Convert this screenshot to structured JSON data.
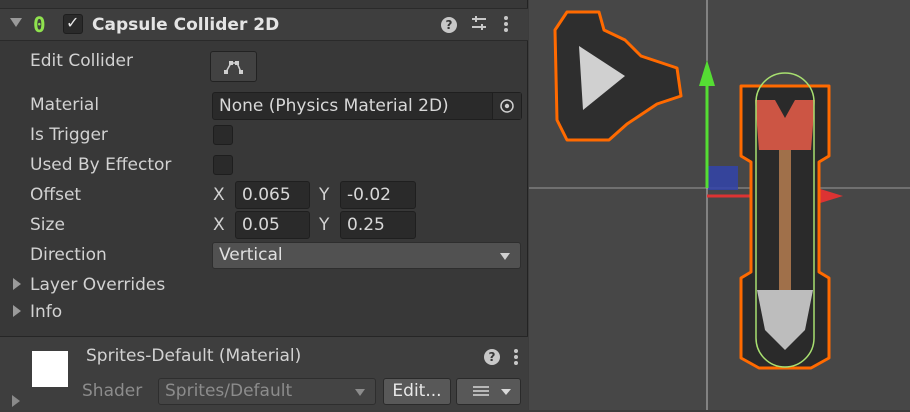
{
  "component": {
    "title": "Capsule Collider 2D",
    "enabled": true,
    "edit_collider_label": "Edit Collider",
    "material_label": "Material",
    "material_value": "None (Physics Material 2D)",
    "is_trigger_label": "Is Trigger",
    "is_trigger": false,
    "used_by_effector_label": "Used By Effector",
    "used_by_effector": false,
    "offset_label": "Offset",
    "offset": {
      "x_label": "X",
      "x": "0.065",
      "y_label": "Y",
      "y": "-0.02"
    },
    "size_label": "Size",
    "size": {
      "x_label": "X",
      "x": "0.05",
      "y_label": "Y",
      "y": "0.25"
    },
    "direction_label": "Direction",
    "direction_value": "Vertical",
    "layer_overrides_label": "Layer Overrides",
    "info_label": "Info"
  },
  "material": {
    "name": "Sprites-Default (Material)",
    "shader_label": "Shader",
    "shader_value": "Sprites/Default",
    "edit_button": "Edit..."
  },
  "colors": {
    "outline": "#ff6a00",
    "collider": "#a8e070",
    "axis_y": "#55dd33",
    "axis_x": "#dd3333",
    "axis_z": "#3344aa"
  }
}
